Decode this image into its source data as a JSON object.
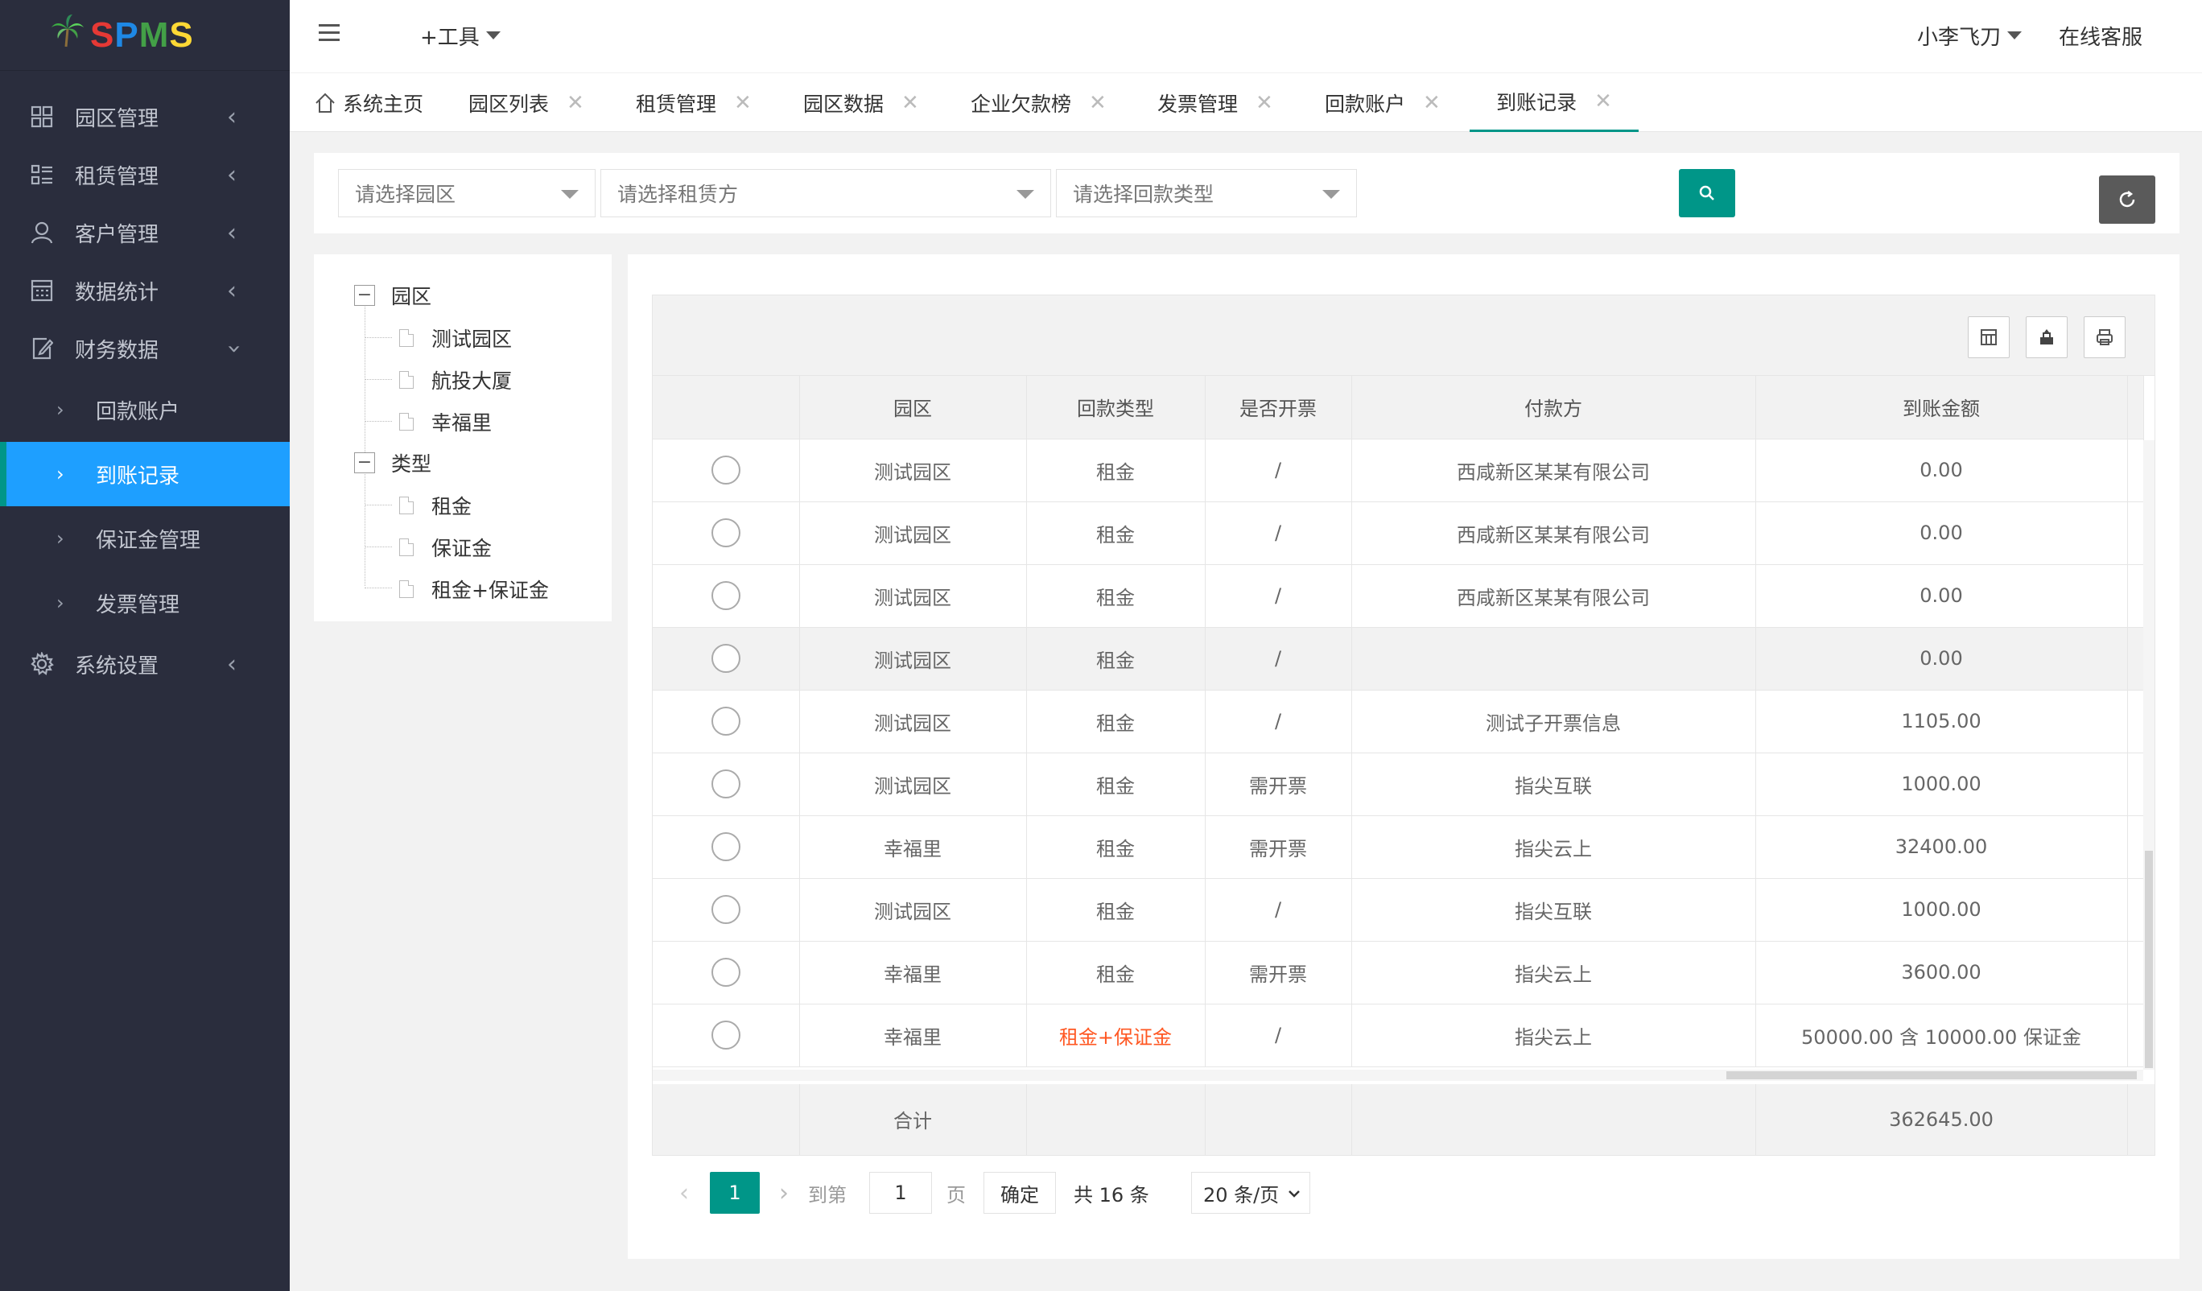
{
  "app": {
    "logo_text": "SPMS",
    "colors": {
      "sidebar_bg": "#2a2d3d",
      "accent": "#009688",
      "active_nav": "#1e9fff",
      "highlight_text": "#ff5722"
    }
  },
  "sidebar": {
    "items": [
      {
        "label": "园区管理",
        "icon": "grid-icon"
      },
      {
        "label": "租赁管理",
        "icon": "list-icon"
      },
      {
        "label": "客户管理",
        "icon": "user-icon"
      },
      {
        "label": "数据统计",
        "icon": "calculator-icon"
      },
      {
        "label": "财务数据",
        "icon": "edit-doc-icon"
      },
      {
        "label": "系统设置",
        "icon": "gear-icon"
      }
    ],
    "sub_items": [
      {
        "label": "回款账户"
      },
      {
        "label": "到账记录"
      },
      {
        "label": "保证金管理"
      },
      {
        "label": "发票管理"
      }
    ]
  },
  "header": {
    "tools_label": "+工具",
    "user_name": "小李飞刀",
    "service_label": "在线客服"
  },
  "tabs": [
    {
      "label": "系统主页"
    },
    {
      "label": "园区列表"
    },
    {
      "label": "租赁管理"
    },
    {
      "label": "园区数据"
    },
    {
      "label": "企业欠款榜"
    },
    {
      "label": "发票管理"
    },
    {
      "label": "回款账户"
    },
    {
      "label": "到账记录"
    }
  ],
  "filters": {
    "park_placeholder": "请选择园区",
    "lessee_placeholder": "请选择租赁方",
    "type_placeholder": "请选择回款类型"
  },
  "tree": {
    "groups": [
      {
        "label": "园区",
        "children": [
          "测试园区",
          "航投大厦",
          "幸福里"
        ]
      },
      {
        "label": "类型",
        "children": [
          "租金",
          "保证金",
          "租金+保证金"
        ]
      }
    ]
  },
  "table": {
    "columns": [
      "园区",
      "回款类型",
      "是否开票",
      "付款方",
      "到账金额"
    ],
    "rows": [
      {
        "park": "测试园区",
        "type": "租金",
        "invoice": "/",
        "payer": "西咸新区某某有限公司",
        "amount": "0.00"
      },
      {
        "park": "测试园区",
        "type": "租金",
        "invoice": "/",
        "payer": "西咸新区某某有限公司",
        "amount": "0.00"
      },
      {
        "park": "测试园区",
        "type": "租金",
        "invoice": "/",
        "payer": "西咸新区某某有限公司",
        "amount": "0.00"
      },
      {
        "park": "测试园区",
        "type": "租金",
        "invoice": "/",
        "payer": "",
        "amount": "0.00"
      },
      {
        "park": "测试园区",
        "type": "租金",
        "invoice": "/",
        "payer": "测试子开票信息",
        "amount": "1105.00"
      },
      {
        "park": "测试园区",
        "type": "租金",
        "invoice": "需开票",
        "payer": "指尖互联",
        "amount": "1000.00"
      },
      {
        "park": "幸福里",
        "type": "租金",
        "invoice": "需开票",
        "payer": "指尖云上",
        "amount": "32400.00"
      },
      {
        "park": "测试园区",
        "type": "租金",
        "invoice": "/",
        "payer": "指尖互联",
        "amount": "1000.00"
      },
      {
        "park": "幸福里",
        "type": "租金",
        "invoice": "需开票",
        "payer": "指尖云上",
        "amount": "3600.00"
      },
      {
        "park": "幸福里",
        "type": "租金+保证金",
        "invoice": "/",
        "payer": "指尖云上",
        "amount": "50000.00 含 10000.00 保证金"
      }
    ],
    "total_label": "合计",
    "total_amount": "362645.00"
  },
  "pager": {
    "current_page": "1",
    "goto_label": "到第",
    "page_input": "1",
    "page_unit": "页",
    "confirm_label": "确定",
    "total_label": "共 16 条",
    "page_size": "20 条/页"
  }
}
